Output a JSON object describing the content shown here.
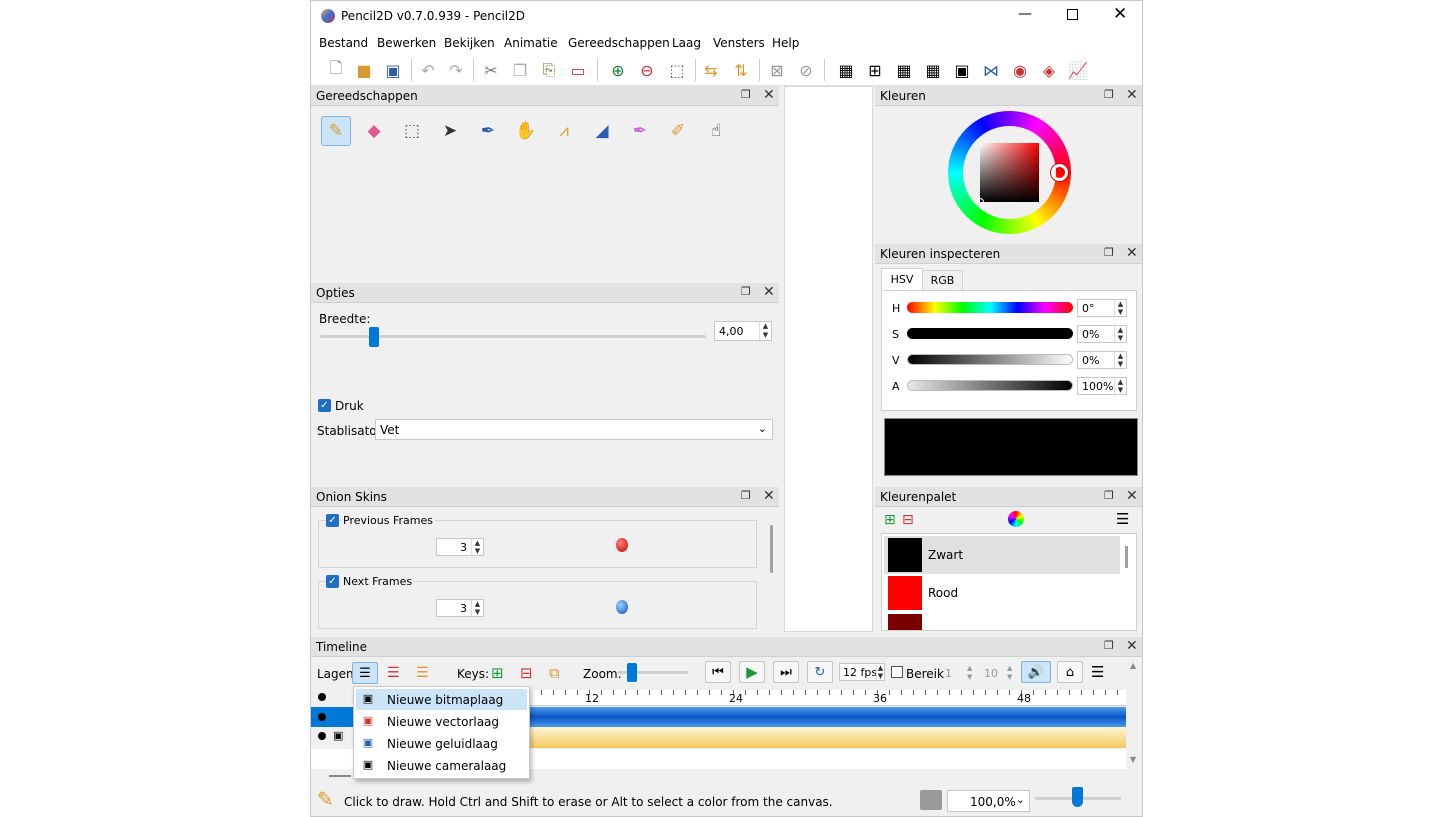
{
  "window": {
    "title": "Pencil2D v0.7.0.939 - Pencil2D"
  },
  "menu": [
    "Bestand",
    "Bewerken",
    "Bekijken",
    "Animatie",
    "Gereedschappen",
    "Laag",
    "Vensters",
    "Help"
  ],
  "panels": {
    "tools": {
      "title": "Gereedschappen"
    },
    "options": {
      "title": "Opties",
      "width_label": "Breedte:",
      "width_value": "4,00",
      "width_fraction": 0.13,
      "pressure_label": "Druk",
      "stabilizer_label": "Stablisator",
      "stabilizer_value": "Vet"
    },
    "onion": {
      "title": "Onion Skins",
      "prev_label": "Previous Frames",
      "prev_value": "3",
      "next_label": "Next Frames",
      "next_value": "3"
    },
    "colors": {
      "title": "Kleuren"
    },
    "inspector": {
      "title": "Kleuren inspecteren",
      "tabs": [
        "HSV",
        "RGB"
      ],
      "rows": [
        {
          "label": "H",
          "value": "0°"
        },
        {
          "label": "S",
          "value": "0%"
        },
        {
          "label": "V",
          "value": "0%"
        },
        {
          "label": "A",
          "value": "100%"
        }
      ],
      "preview_color": "#000000"
    },
    "palette": {
      "title": "Kleurenpalet",
      "swatches": [
        {
          "name": "Zwart",
          "color": "#000000"
        },
        {
          "name": "Rood",
          "color": "#ff0000"
        },
        {
          "name": "",
          "color": "#7a0000"
        }
      ]
    }
  },
  "timeline": {
    "title": "Timeline",
    "layers_label": "Lagen:",
    "keys_label": "Keys:",
    "zoom_label": "Zoom:",
    "fps": "12 fps",
    "range_label": "Bereik",
    "range_start": "1",
    "range_end": "10",
    "ruler": [
      "12",
      "24",
      "36",
      "48"
    ]
  },
  "layer_menu": {
    "items": [
      {
        "label": "Nieuwe bitmaplaag",
        "icon": "bitmap-layer-icon"
      },
      {
        "label": "Nieuwe vectorlaag",
        "icon": "vector-layer-icon"
      },
      {
        "label": "Nieuwe geluidlaag",
        "icon": "sound-layer-icon"
      },
      {
        "label": "Nieuwe cameralaag",
        "icon": "camera-layer-icon"
      }
    ]
  },
  "statusbar": {
    "message": "Click to draw. Hold Ctrl and Shift to erase or Alt to select a color from the canvas.",
    "zoom": "100,0%"
  },
  "colors": {
    "accent": "#0078d7",
    "selection": "#cce4f7",
    "panel_bg": "#f0f0f0"
  }
}
